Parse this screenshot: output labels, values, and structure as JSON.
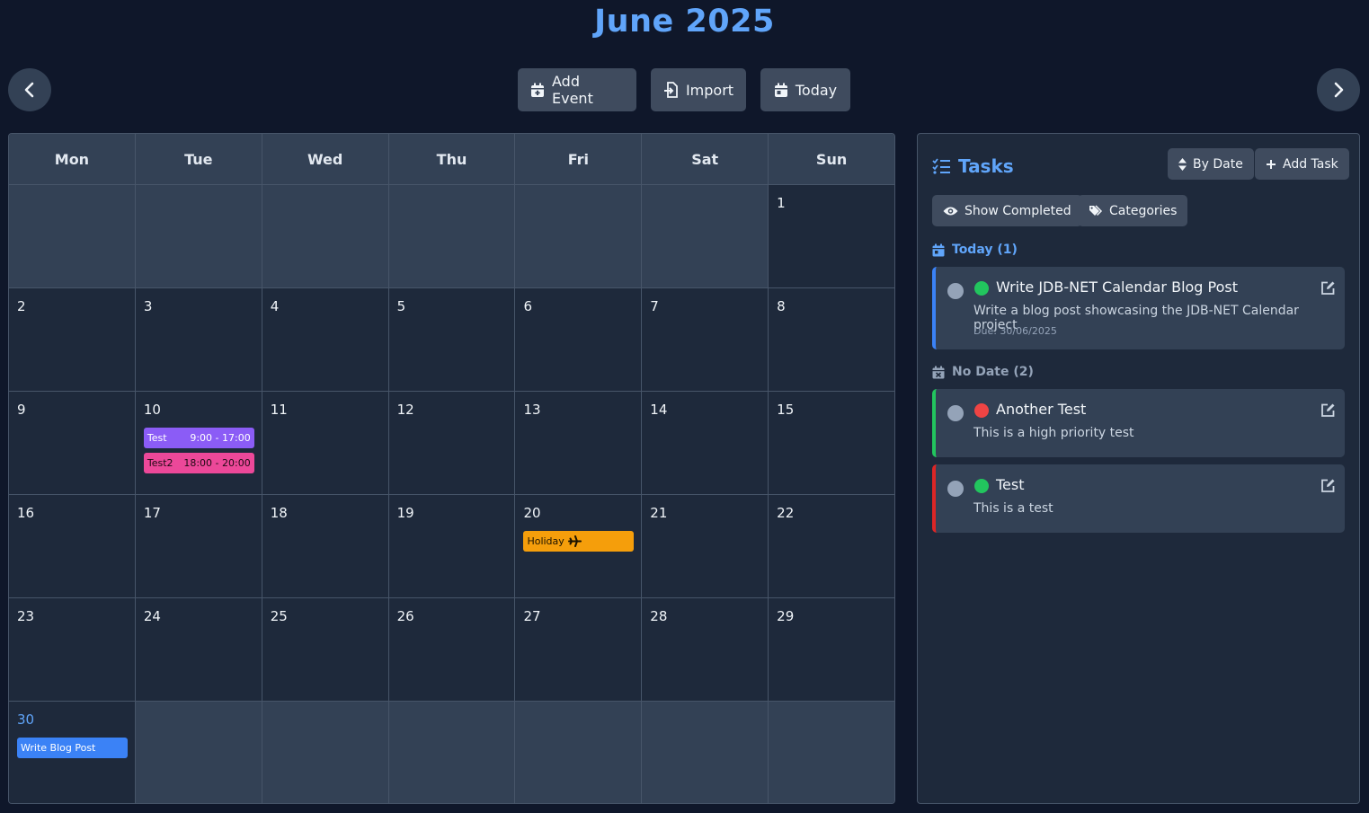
{
  "header": {
    "title": "June 2025",
    "add_event_label": "Add Event",
    "import_label": "Import",
    "today_label": "Today",
    "prev_icon": "chevron-left-icon",
    "next_icon": "chevron-right-icon"
  },
  "calendar": {
    "weekdays": [
      "Mon",
      "Tue",
      "Wed",
      "Thu",
      "Fri",
      "Sat",
      "Sun"
    ],
    "weeks": [
      [
        "",
        "",
        "",
        "",
        "",
        "",
        "1"
      ],
      [
        "2",
        "3",
        "4",
        "5",
        "6",
        "7",
        "8"
      ],
      [
        "9",
        "10",
        "11",
        "12",
        "13",
        "14",
        "15"
      ],
      [
        "16",
        "17",
        "18",
        "19",
        "20",
        "21",
        "22"
      ],
      [
        "23",
        "24",
        "25",
        "26",
        "27",
        "28",
        "29"
      ],
      [
        "30",
        "",
        "",
        "",
        "",
        "",
        ""
      ]
    ],
    "events": {
      "test": {
        "name": "Test",
        "time": "9:00 - 17:00",
        "color": "#8b5cf6"
      },
      "test2": {
        "name": "Test2",
        "time": "18:00 - 20:00",
        "color": "#ec4899"
      },
      "holiday": {
        "name": "Holiday",
        "icon": "plane-icon",
        "color": "#f59e0b"
      },
      "blog": {
        "name": "Write Blog Post",
        "color": "#3b82f6"
      }
    }
  },
  "tasks": {
    "title": "Tasks",
    "by_date_label": "By Date",
    "add_task_label": "Add Task",
    "show_completed_label": "Show Completed",
    "categories_label": "Categories",
    "today_section": "Today (1)",
    "no_date_section": "No Date (2)",
    "items": [
      {
        "title": "Write JDB-NET Calendar Blog Post",
        "description": "Write a blog post showcasing the JDB-NET Calendar project",
        "due": "Due: 30/06/2025",
        "priority_color": "#22c55e",
        "border_color": "#3b82f6"
      },
      {
        "title": "Another Test",
        "description": "This is a high priority test",
        "priority_color": "#ef4444",
        "border_color": "#22c55e"
      },
      {
        "title": "Test",
        "description": "This is a test",
        "priority_color": "#22c55e",
        "border_color": "#dc2626"
      }
    ]
  }
}
